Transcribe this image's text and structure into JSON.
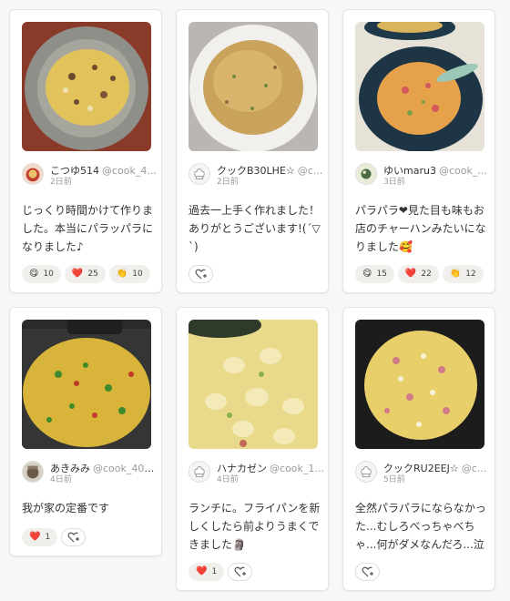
{
  "cards": [
    {
      "user_name": "こつゆ514",
      "user_id": "@cook_4...",
      "date": "2日前",
      "comment": "じっくり時間かけて作りました。本当にパラッパラになりました♪",
      "reactions": [
        {
          "emoji": "😋",
          "count": "10"
        },
        {
          "emoji": "❤️",
          "count": "25"
        },
        {
          "emoji": "👏",
          "count": "10"
        }
      ]
    },
    {
      "user_name": "クックB30LHE☆",
      "user_id": "@c...",
      "date": "2日前",
      "comment": "過去一上手く作れました！ありがとうございます!(´▽`)",
      "reactions": []
    },
    {
      "user_name": "ゆいmaru3",
      "user_id": "@cook_...",
      "date": "3日前",
      "comment": "パラパラ❤見た目も味もお店のチャーハンみたいになりました🥰",
      "reactions": [
        {
          "emoji": "😋",
          "count": "15"
        },
        {
          "emoji": "❤️",
          "count": "22"
        },
        {
          "emoji": "👏",
          "count": "12"
        }
      ]
    },
    {
      "user_name": "あきみみ",
      "user_id": "@cook_400...",
      "date": "4日前",
      "comment": "我が家の定番です",
      "reactions": [
        {
          "emoji": "❤️",
          "count": "1"
        }
      ]
    },
    {
      "user_name": "ハナカゼン",
      "user_id": "@cook_1...",
      "date": "4日前",
      "comment": "ランチに。フライパンを新しくしたら前よりうまくできました🗿",
      "reactions": [
        {
          "emoji": "❤️",
          "count": "1"
        }
      ]
    },
    {
      "user_name": "クックRU2EEJ☆",
      "user_id": "@c...",
      "date": "5日前",
      "comment": "全然パラパラにならなかった...むしろべっちゃべちゃ...何がダメなんだろ...泣",
      "reactions": []
    }
  ],
  "icons": {
    "add_reaction": "add-reaction-icon",
    "default_avatar": "chef-hat-avatar-icon"
  },
  "colors": {
    "rice_yellow": "#e2c25a",
    "plate_gray": "#8e8f88"
  }
}
